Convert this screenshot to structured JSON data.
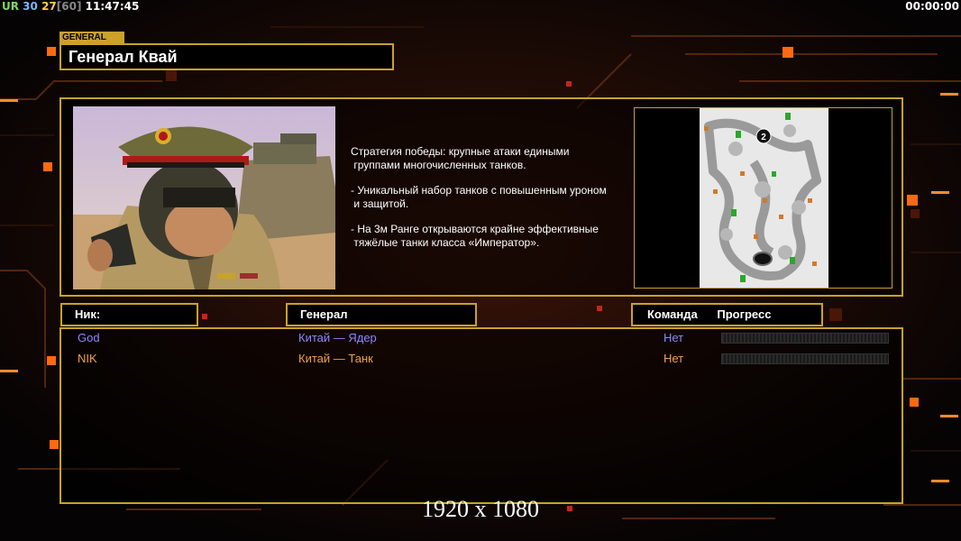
{
  "hud": {
    "ur": "UR",
    "v1": "30",
    "v2": "27",
    "v3": "[60]",
    "clock": "11:47:45",
    "timer": "00:00:00"
  },
  "general": {
    "tag": "GENERAL",
    "name": "Генерал Квай",
    "strategy_line1": "Стратегия победы: крупные атаки едиными",
    "strategy_line2": " группами многочисленных танков.",
    "bullet1_line1": "- Уникальный набор танков с повышенным уроном",
    "bullet1_line2": " и защитой.",
    "bullet2_line1": "- На 3м Ранге открываются крайне эффективные",
    "bullet2_line2": " тяжёлые танки класса «Император».",
    "minimap_start_label": "2"
  },
  "table": {
    "col_nick": "Ник:",
    "col_general": "Генерал",
    "col_team": "Команда",
    "col_progress": "Прогресс",
    "rows": [
      {
        "nick": "God",
        "general": "Китай — Ядер",
        "team": "Нет",
        "progress": 0,
        "color": "#8f86ff"
      },
      {
        "nick": "NIK",
        "general": "Китай — Танк",
        "team": "Нет",
        "progress": 0,
        "color": "#f0a050"
      }
    ]
  },
  "resolution": "1920 x 1080",
  "colors": {
    "gold_border": "#c9a227",
    "accent_orange": "#ff7a1a",
    "hud_green": "#7dd860",
    "hud_blue": "#7fb3ff",
    "hud_yellow": "#ffd23a"
  }
}
